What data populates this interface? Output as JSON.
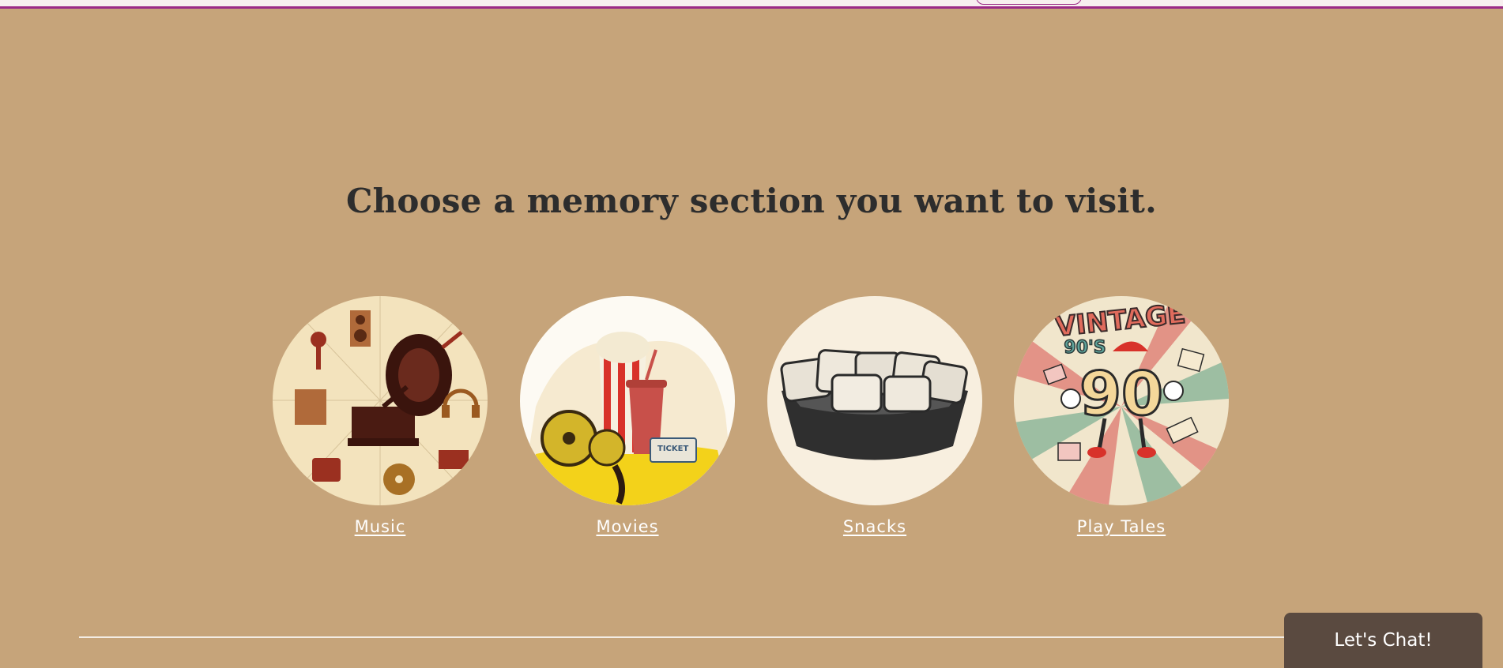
{
  "heading": "Choose a memory section you want to visit.",
  "sections": [
    {
      "label": "Music",
      "image": "gramophone-music-illustration"
    },
    {
      "label": "Movies",
      "image": "popcorn-film-reel-illustration"
    },
    {
      "label": "Snacks",
      "image": "pastry-basket-illustration"
    },
    {
      "label": "Play Tales",
      "image": "vintage-90s-mascot-illustration"
    }
  ],
  "vintage_badge": {
    "line1": "VINTAGE",
    "line2": "90'S",
    "line3": "90"
  },
  "ticket_text": "TICKET",
  "chat_button": "Let's Chat!",
  "colors": {
    "background": "#c6a47a",
    "heading": "#2d2d2d",
    "chat": "#5a4a40",
    "topbar_accent": "#9b2a86"
  }
}
